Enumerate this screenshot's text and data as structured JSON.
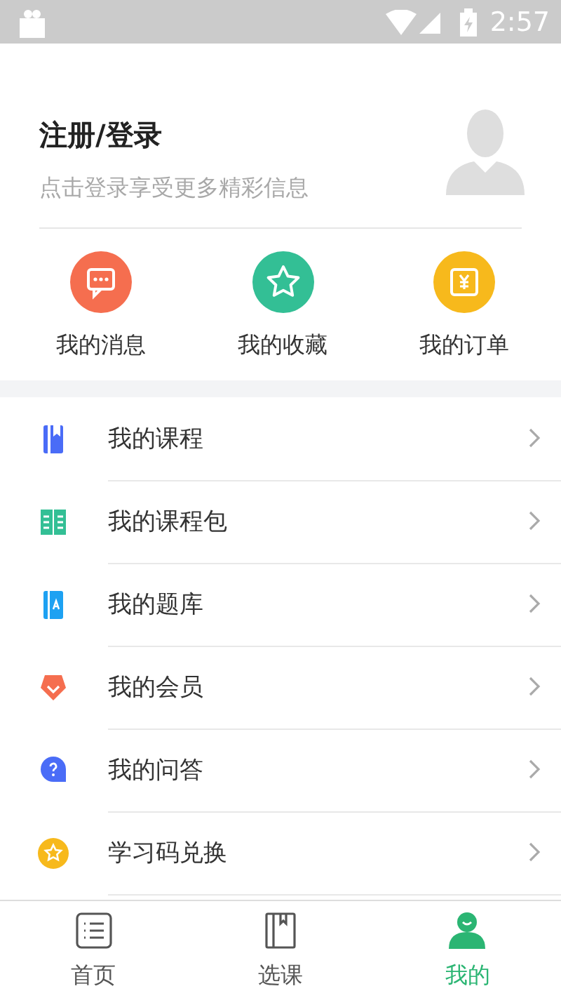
{
  "status_bar": {
    "time": "2:57"
  },
  "profile": {
    "title": "注册/登录",
    "subtitle": "点击登录享受更多精彩信息"
  },
  "shortcuts": [
    {
      "kind": "message",
      "label": "我的消息",
      "color": "#f56e4f"
    },
    {
      "kind": "star",
      "label": "我的收藏",
      "color": "#33bf95"
    },
    {
      "kind": "order",
      "label": "我的订单",
      "color": "#f7b91c"
    }
  ],
  "menu": [
    {
      "kind": "course",
      "label": "我的课程"
    },
    {
      "kind": "package",
      "label": "我的课程包"
    },
    {
      "kind": "bank",
      "label": "我的题库"
    },
    {
      "kind": "member",
      "label": "我的会员"
    },
    {
      "kind": "qa",
      "label": "我的问答"
    },
    {
      "kind": "code",
      "label": "学习码兑换"
    }
  ],
  "tabs": [
    {
      "kind": "home",
      "label": "首页",
      "selected": false
    },
    {
      "kind": "courses",
      "label": "选课",
      "selected": false
    },
    {
      "kind": "me",
      "label": "我的",
      "selected": true
    }
  ]
}
